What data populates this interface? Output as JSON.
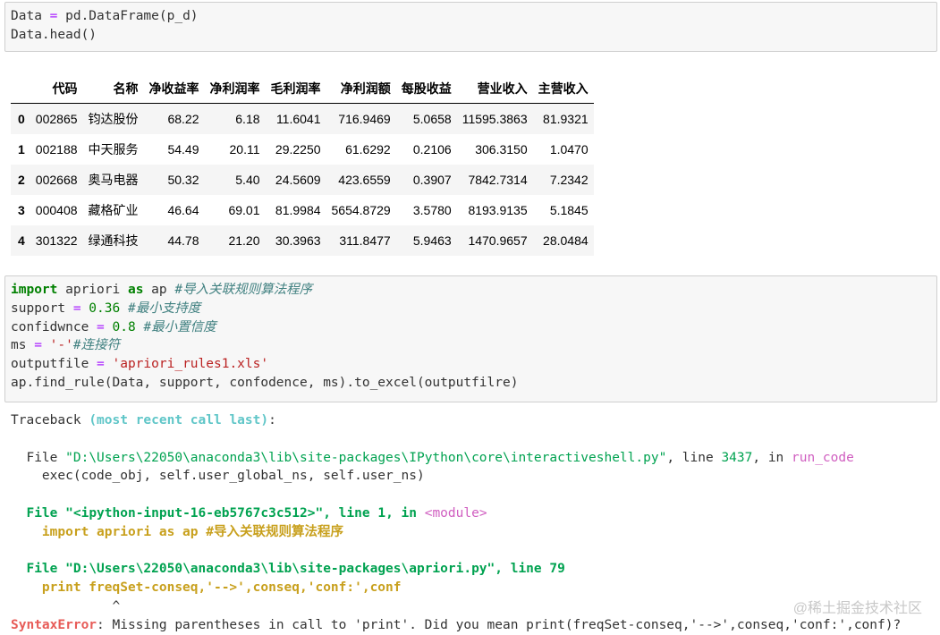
{
  "cell1": {
    "line1": {
      "a": "Data ",
      "op": "=",
      "b": " pd.DataFrame(p_d)"
    },
    "line2": "Data.head()"
  },
  "table": {
    "headers": [
      "",
      "代码",
      "名称",
      "净收益率",
      "净利润率",
      "毛利润率",
      "净利润额",
      "每股收益",
      "营业收入",
      "主营收入"
    ],
    "rows": [
      [
        "0",
        "002865",
        "钧达股份",
        "68.22",
        "6.18",
        "11.6041",
        "716.9469",
        "5.0658",
        "11595.3863",
        "81.9321"
      ],
      [
        "1",
        "002188",
        "中天服务",
        "54.49",
        "20.11",
        "29.2250",
        "61.6292",
        "0.2106",
        "306.3150",
        "1.0470"
      ],
      [
        "2",
        "002668",
        "奥马电器",
        "50.32",
        "5.40",
        "24.5609",
        "423.6559",
        "0.3907",
        "7842.7314",
        "7.2342"
      ],
      [
        "3",
        "000408",
        "藏格矿业",
        "46.64",
        "69.01",
        "81.9984",
        "5654.8729",
        "3.5780",
        "8193.9135",
        "5.1845"
      ],
      [
        "4",
        "301322",
        "绿通科技",
        "44.78",
        "21.20",
        "30.3963",
        "311.8477",
        "5.9463",
        "1470.9657",
        "28.0484"
      ]
    ]
  },
  "cell2": {
    "l1": {
      "kw": "import",
      "a": " apriori ",
      "kw2": "as",
      "b": " ap ",
      "cmt": "#导入关联规则算法程序"
    },
    "l2": {
      "a": "support ",
      "op": "=",
      "num": " 0.36 ",
      "cmt": "#最小支持度"
    },
    "l3": {
      "a": "confidwnce ",
      "op": "=",
      "num": " 0.8 ",
      "cmt": "#最小置信度"
    },
    "l4": {
      "a": "ms ",
      "op": "=",
      "str": " '-'",
      "cmt": "#连接符"
    },
    "l5": {
      "a": "outputfile ",
      "op": "=",
      "str": " 'apriori_rules1.xls'"
    },
    "l6": "ap.find_rule(Data, support, confodence, ms).to_excel(outputfilre)"
  },
  "traceback": {
    "head_a": "Traceback ",
    "head_b": "(most recent call last)",
    "head_c": ":",
    "f1_file": "File ",
    "f1_path": "\"D:\\Users\\22050\\anaconda3\\lib\\site-packages\\IPython\\core\\interactiveshell.py\"",
    "f1_line_pre": ", line ",
    "f1_line": "3437",
    "f1_in": ", in ",
    "f1_func": "run_code",
    "f1_code": "    exec(code_obj, self.user_global_ns, self.user_ns)",
    "f2_file": "File ",
    "f2_path": "\"<ipython-input-16-eb5767c3c512>\"",
    "f2_line_pre": ", line ",
    "f2_line": "1",
    "f2_in": ", in ",
    "f2_func": "<module>",
    "f2_code": "    import apriori as ap #导入关联规则算法程序",
    "f3_file": "File ",
    "f3_path": "\"D:\\Users\\22050\\anaconda3\\lib\\site-packages\\apriori.py\"",
    "f3_line_pre": ", line ",
    "f3_line": "79",
    "f3_code": "    print freqSet-conseq,'-->',conseq,'conf:',conf",
    "f3_caret": "             ^",
    "err_name": "SyntaxError",
    "err_msg": ": Missing parentheses in call to 'print'. Did you mean print(freqSet-conseq,'-->',conseq,'conf:',conf)?"
  },
  "watermark": "@稀土掘金技术社区"
}
